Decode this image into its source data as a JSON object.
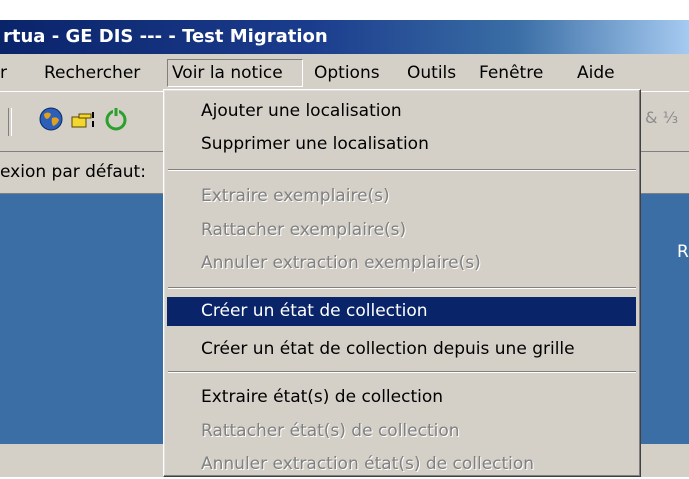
{
  "window": {
    "title": "rtua - GE DIS --- - Test Migration"
  },
  "menubar": {
    "items": [
      {
        "label": "r"
      },
      {
        "label": "Rechercher"
      },
      {
        "label": "Voir la notice"
      },
      {
        "label": "Options"
      },
      {
        "label": "Outils"
      },
      {
        "label": "Fenêtre"
      },
      {
        "label": "Aide"
      }
    ]
  },
  "toolbar": {
    "icons": [
      "globe-icon",
      "pointing-hand-icon",
      "refresh-icon"
    ],
    "right_glyphs": "& ⅓"
  },
  "status": {
    "connection_label": "exion par défaut:"
  },
  "right_panel": {
    "text": "R"
  },
  "dropdown": {
    "items": [
      {
        "label": "Ajouter une localisation",
        "enabled": true
      },
      {
        "label": "Supprimer une localisation",
        "enabled": true
      },
      {
        "label": "Extraire exemplaire(s)",
        "enabled": false
      },
      {
        "label": "Rattacher exemplaire(s)",
        "enabled": false
      },
      {
        "label": "Annuler extraction exemplaire(s)",
        "enabled": false
      },
      {
        "label": "Créer un état de collection",
        "enabled": true,
        "highlighted": true
      },
      {
        "label": "Créer un état de collection depuis une grille",
        "enabled": true
      },
      {
        "label": "Extraire état(s) de collection",
        "enabled": true
      },
      {
        "label": "Rattacher état(s) de collection",
        "enabled": false
      },
      {
        "label": "Annuler extraction état(s) de collection",
        "enabled": false
      }
    ]
  },
  "colors": {
    "title_bar": "#0a246a",
    "highlight": "#0a246a",
    "face": "#d4d0c8",
    "workspace": "#3a6ea5"
  }
}
